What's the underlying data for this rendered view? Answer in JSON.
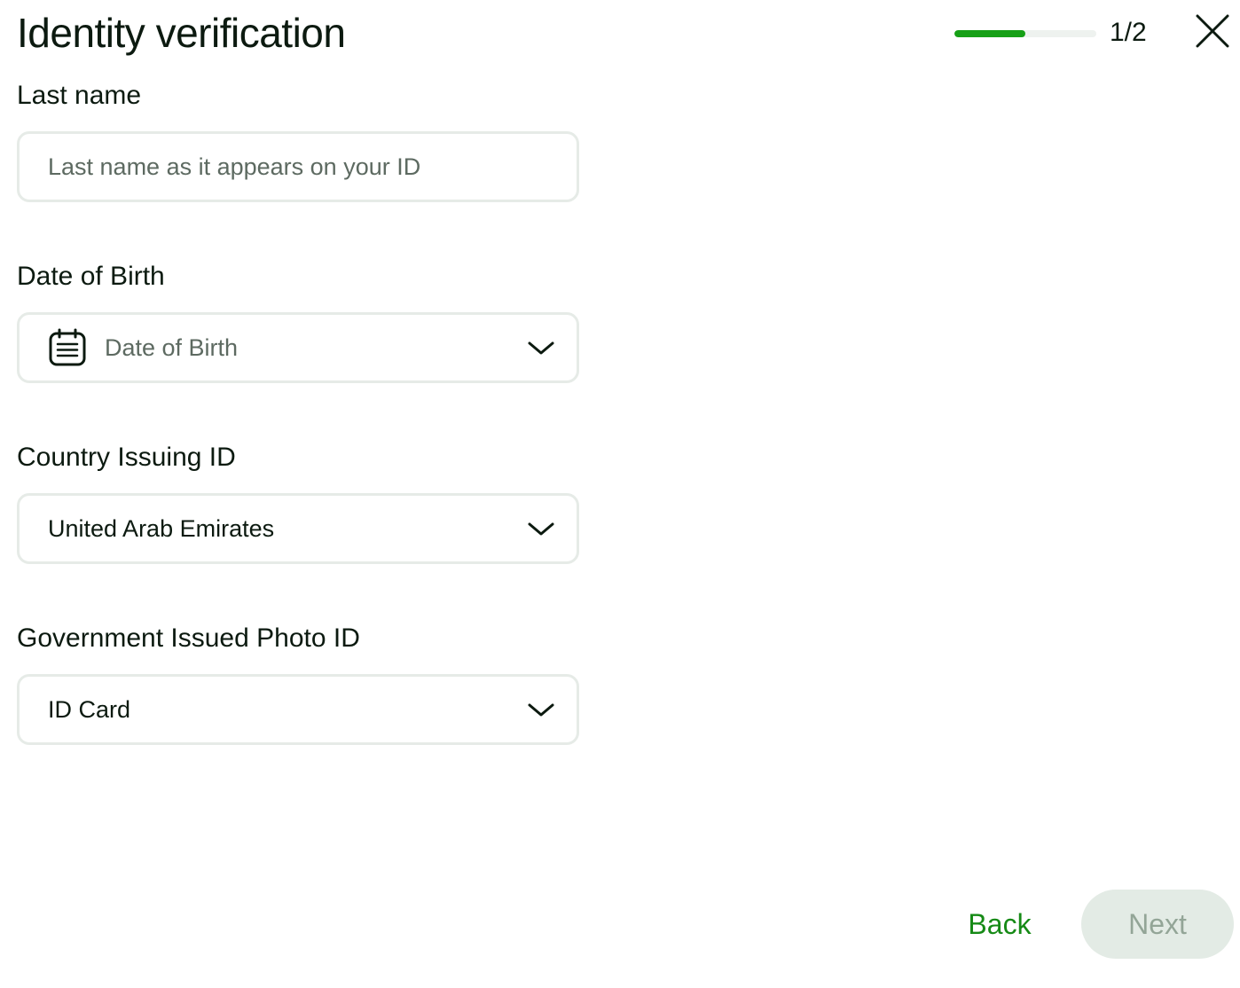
{
  "header": {
    "title": "Identity verification",
    "progress": {
      "current": 1,
      "total": 2,
      "fraction": 0.5,
      "label": "1/2"
    },
    "close_icon": "close-icon"
  },
  "form": {
    "last_name": {
      "label": "Last name",
      "value": "",
      "placeholder": "Last name as it appears on your ID"
    },
    "date_of_birth": {
      "label": "Date of Birth",
      "placeholder": "Date of Birth",
      "icon": "calendar-icon"
    },
    "country": {
      "label": "Country Issuing ID",
      "value": "United Arab Emirates"
    },
    "photo_id": {
      "label": "Government Issued Photo ID",
      "value": "ID Card"
    }
  },
  "footer": {
    "back_label": "Back",
    "next_label": "Next"
  },
  "colors": {
    "accent": "#16a016",
    "back_text": "#168a16",
    "next_disabled_bg": "#e3ebe5",
    "next_disabled_text": "#93a597",
    "field_border": "#e6ebe7"
  }
}
